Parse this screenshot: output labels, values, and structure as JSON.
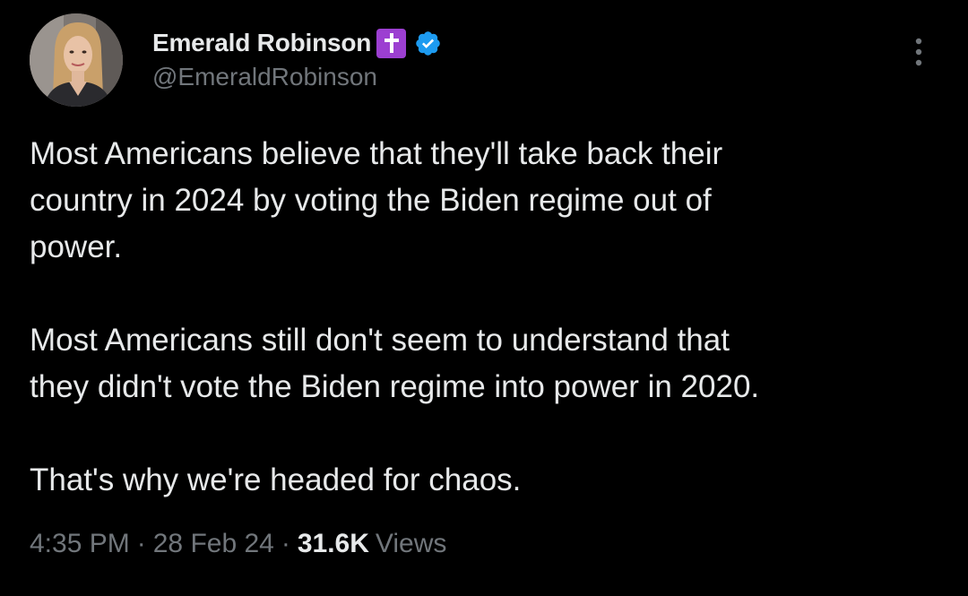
{
  "author": {
    "display_name": "Emerald Robinson",
    "handle": "@EmeraldRobinson",
    "badges": [
      "latin-cross-icon",
      "verified-checkmark-icon"
    ]
  },
  "tweet": {
    "paragraphs": [
      "Most Americans believe that they'll take back their\ncountry in 2024 by voting the Biden regime out of\npower.",
      "Most Americans still don't seem to understand that\nthey didn't vote the Biden regime into power in 2020.",
      "That's why we're headed for chaos."
    ]
  },
  "meta": {
    "time": "4:35 PM",
    "date": "28 Feb 24",
    "views_count": "31.6K",
    "views_label": "Views",
    "separator": "·"
  },
  "icons": {
    "more": "more-vertical-icon"
  },
  "colors": {
    "background": "#000000",
    "primary_text": "#e7e9ea",
    "secondary_text": "#71767b",
    "verified_blue": "#1d9bf0",
    "cross_badge_bg": "#9c3fd1"
  }
}
